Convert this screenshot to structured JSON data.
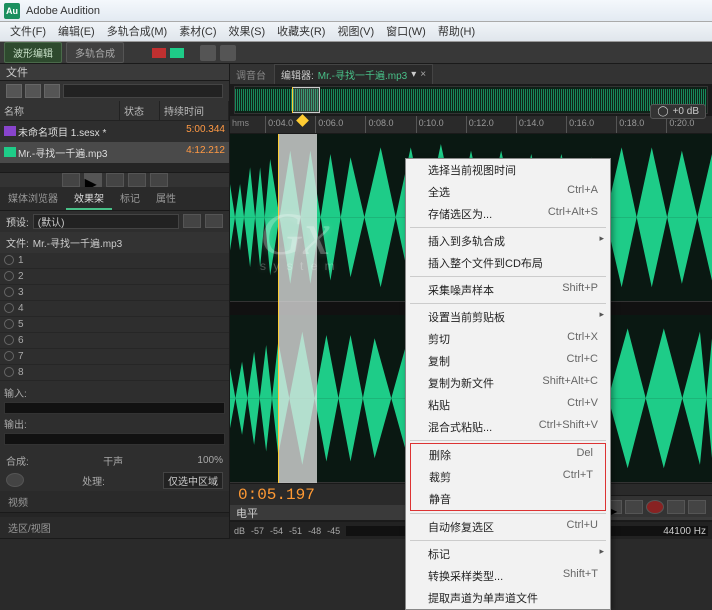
{
  "title": "Adobe Audition",
  "menubar": [
    "文件(F)",
    "编辑(E)",
    "多轨合成(M)",
    "素材(C)",
    "效果(S)",
    "收藏夹(R)",
    "视图(V)",
    "窗口(W)",
    "帮助(H)"
  ],
  "toolbar_tabs": {
    "wave": "波形编辑",
    "multi": "多轨合成"
  },
  "files_panel": {
    "title": "文件",
    "headers": {
      "name": "名称",
      "status": "状态",
      "duration": "持续时间"
    },
    "rows": [
      {
        "icon": "proj",
        "name": "未命名项目 1.sesx *",
        "duration": "5:00.344"
      },
      {
        "icon": "audio",
        "name": "Mr.-寻找一千遍.mp3",
        "duration": "4:12.212",
        "selected": true
      }
    ]
  },
  "fx_panel": {
    "tabs": [
      "媒体浏览器",
      "效果架",
      "标记",
      "属性"
    ],
    "active_tab": 1,
    "preset_label": "预设:",
    "preset_value": "(默认)",
    "file_label": "文件:",
    "file_value": "Mr.-寻找一千遍.mp3",
    "slot_count": 8,
    "io_labels": [
      "输入:",
      "输出:"
    ],
    "mix_label": "合成:",
    "wet_dry": [
      "干声",
      "100%"
    ],
    "process_label": "处理:",
    "process_value": "仅选中区域"
  },
  "bottom_tabs": [
    "视频",
    "选区/视图"
  ],
  "editor": {
    "mixer_tab": "调音台",
    "editor_label": "编辑器:",
    "filename": "Mr.-寻找一千遍.mp3",
    "ruler_unit": "hms",
    "ruler_marks": [
      "0:04.0",
      "0:06.0",
      "0:08.0",
      "0:10.0",
      "0:12.0",
      "0:14.0",
      "0:16.0",
      "0:18.0",
      "0:20.0"
    ],
    "db_badge": "+0 dB",
    "timecode": "0:05.197",
    "level_tab": "电平",
    "level_marks": [
      "dB",
      "-57",
      "-54",
      "-51",
      "-48",
      "-45"
    ],
    "samplerate": "44100 Hz"
  },
  "context_menu": {
    "items": [
      {
        "label": "选择当前视图时间",
        "shortcut": ""
      },
      {
        "label": "全选",
        "shortcut": "Ctrl+A"
      },
      {
        "label": "存储选区为...",
        "shortcut": "Ctrl+Alt+S",
        "sep_after": true
      },
      {
        "label": "插入到多轨合成",
        "sub": true
      },
      {
        "label": "插入整个文件到CD布局",
        "sep_after": true
      },
      {
        "label": "采集噪声样本",
        "shortcut": "Shift+P",
        "sep_after": true
      },
      {
        "label": "设置当前剪贴板",
        "sub": true
      },
      {
        "label": "剪切",
        "shortcut": "Ctrl+X"
      },
      {
        "label": "复制",
        "shortcut": "Ctrl+C"
      },
      {
        "label": "复制为新文件",
        "shortcut": "Shift+Alt+C"
      },
      {
        "label": "粘贴",
        "shortcut": "Ctrl+V"
      },
      {
        "label": "混合式粘贴...",
        "shortcut": "Ctrl+Shift+V",
        "sep_after": true
      },
      {
        "label": "删除",
        "shortcut": "Del",
        "group_start": true
      },
      {
        "label": "裁剪",
        "shortcut": "Ctrl+T"
      },
      {
        "label": "静音",
        "group_end": true,
        "sep_after": true
      },
      {
        "label": "自动修复选区",
        "shortcut": "Ctrl+U",
        "sep_after": true
      },
      {
        "label": "标记",
        "sub": true
      },
      {
        "label": "转换采样类型...",
        "shortcut": "Shift+T"
      },
      {
        "label": "提取声道为单声道文件"
      }
    ]
  }
}
